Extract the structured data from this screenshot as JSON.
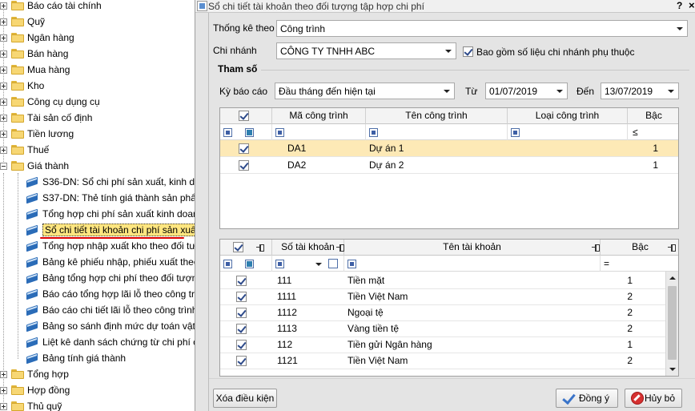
{
  "tree": {
    "top_items": [
      {
        "label": "Báo cáo tài chính",
        "expanded": false
      },
      {
        "label": "Quỹ",
        "expanded": false
      },
      {
        "label": "Ngân hàng",
        "expanded": false
      },
      {
        "label": "Bán hàng",
        "expanded": false
      },
      {
        "label": "Mua hàng",
        "expanded": false
      },
      {
        "label": "Kho",
        "expanded": false
      },
      {
        "label": "Công cụ dụng cụ",
        "expanded": false
      },
      {
        "label": "Tài sản cố định",
        "expanded": false
      },
      {
        "label": "Tiền lương",
        "expanded": false
      },
      {
        "label": "Thuế",
        "expanded": false
      },
      {
        "label": "Giá thành",
        "expanded": true
      }
    ],
    "gia_thanh_reports": [
      "S36-DN: Sổ chi phí sản xuất, kinh do",
      "S37-DN: Thẻ tính giá thành sản phẩ",
      "Tổng hợp chi phí sản xuất kinh doan",
      "Sổ chi tiết tài khoản chi phí sản xuất",
      "Tổng hợp nhập xuất kho theo đối tượ",
      "Bảng kê phiếu nhập, phiếu xuất theo",
      "Bảng tổng hợp chi phí theo đối tượng",
      "Báo cáo tổng hợp lãi lỗ theo công trìn",
      "Báo cáo chi tiết lãi lỗ theo công trình",
      "Bảng so sánh định mức dự toán vật t",
      "Liệt kê danh sách chứng từ chi phí ch",
      "Bảng tính giá thành"
    ],
    "bottom_items": [
      {
        "label": "Tổng hợp",
        "expanded": false
      },
      {
        "label": "Hợp đồng",
        "expanded": false
      },
      {
        "label": "Thủ quỹ",
        "expanded": false
      }
    ],
    "active_report_index": 3
  },
  "dialog": {
    "title": "Sổ chi tiết tài khoản theo đối tượng tập hợp chi phí",
    "help": "?",
    "close": "×",
    "thong_ke_theo": {
      "label": "Thống kê theo",
      "value": "Công trình"
    },
    "chi_nhanh": {
      "label": "Chi nhánh",
      "value": "CÔNG TY TNHH ABC"
    },
    "bao_gom": {
      "label": "Bao gồm số liệu chi nhánh phụ thuộc",
      "checked": true
    },
    "tham_so": "Tham số",
    "ky_bao_cao": {
      "label": "Kỳ báo cáo",
      "value": "Đầu tháng đến hiện tại"
    },
    "tu": {
      "label": "Từ",
      "value": "01/07/2019"
    },
    "den": {
      "label": "Đến",
      "value": "13/07/2019"
    },
    "cong_trinh_grid": {
      "columns": [
        "Mã công trình",
        "Tên công trình",
        "Loại công trình",
        "Bậc"
      ],
      "filter_op": "≤",
      "rows": [
        {
          "checked": true,
          "ma": "DA1",
          "ten": "Dự án 1",
          "loai": "",
          "bac": "1"
        },
        {
          "checked": true,
          "ma": "DA2",
          "ten": "Dự án 2",
          "loai": "",
          "bac": "1"
        }
      ]
    },
    "tai_khoan_grid": {
      "columns": [
        "Số tài khoản",
        "Tên tài khoản",
        "Bậc"
      ],
      "filter_op": "=",
      "rows": [
        {
          "checked": true,
          "so": "111",
          "ten": "Tiền mặt",
          "bac": "1"
        },
        {
          "checked": true,
          "so": "1111",
          "ten": "Tiền Việt Nam",
          "bac": "2"
        },
        {
          "checked": true,
          "so": "1112",
          "ten": "Ngoại tệ",
          "bac": "2"
        },
        {
          "checked": true,
          "so": "1113",
          "ten": "Vàng tiền tệ",
          "bac": "2"
        },
        {
          "checked": true,
          "so": "112",
          "ten": "Tiền gửi Ngân hàng",
          "bac": "1"
        },
        {
          "checked": true,
          "so": "1121",
          "ten": "Tiền Việt Nam",
          "bac": "2"
        }
      ]
    },
    "buttons": {
      "clear": "Xóa điều kiện",
      "ok": "Đồng ý",
      "cancel": "Hủy bỏ"
    }
  }
}
